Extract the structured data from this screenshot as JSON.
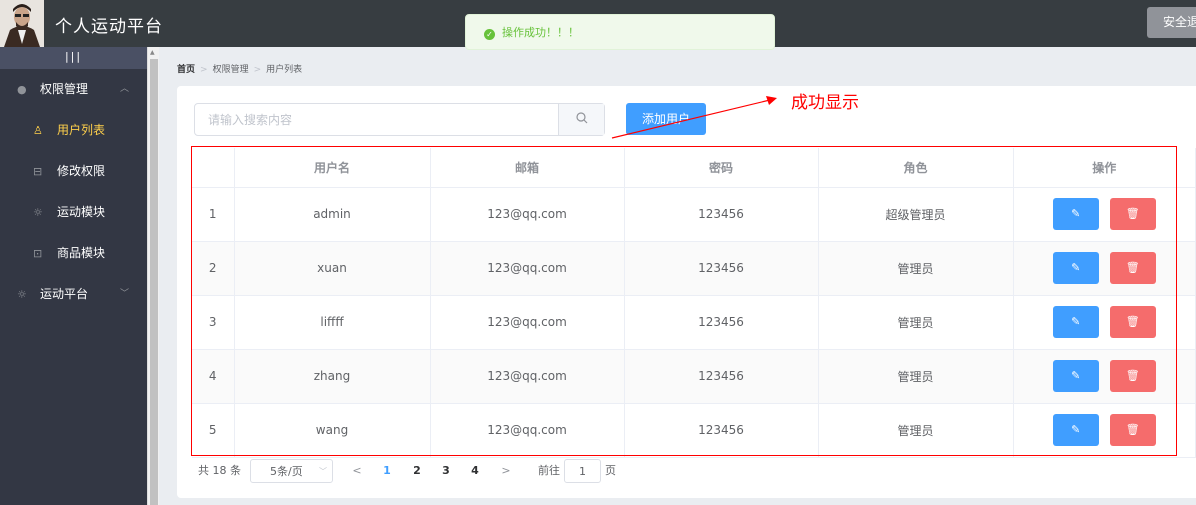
{
  "header": {
    "title": "个人运动平台",
    "logout_label": "安全退出"
  },
  "toast": {
    "icon": "check-circle-icon",
    "message": "操作成功！！！",
    "color": "#67c23a"
  },
  "sidebar": {
    "toggle_label": "|||",
    "items": [
      {
        "label": "权限管理",
        "icon": "user-icon",
        "expanded": true
      },
      {
        "label": "用户列表",
        "icon": "user-outline-icon",
        "active": true
      },
      {
        "label": "修改权限",
        "icon": "lock-icon"
      },
      {
        "label": "运动模块",
        "icon": "sun-icon"
      },
      {
        "label": "商品模块",
        "icon": "goods-icon"
      },
      {
        "label": "运动平台",
        "icon": "sun-icon",
        "expanded": false
      }
    ],
    "active_color": "#ffd04b"
  },
  "breadcrumb": [
    "首页",
    "权限管理",
    "用户列表"
  ],
  "search": {
    "placeholder": "请输入搜索内容",
    "value": ""
  },
  "add_button_label": "添加用户",
  "annotation": {
    "text": "成功显示",
    "color": "#ff0000"
  },
  "table": {
    "columns": [
      "",
      "用户名",
      "邮箱",
      "密码",
      "角色",
      "操作"
    ],
    "rows": [
      {
        "index": "1",
        "username": "admin",
        "email": "123@qq.com",
        "password": "123456",
        "role": "超级管理员"
      },
      {
        "index": "2",
        "username": "xuan",
        "email": "123@qq.com",
        "password": "123456",
        "role": "管理员"
      },
      {
        "index": "3",
        "username": "liffff",
        "email": "123@qq.com",
        "password": "123456",
        "role": "管理员"
      },
      {
        "index": "4",
        "username": "zhang",
        "email": "123@qq.com",
        "password": "123456",
        "role": "管理员"
      },
      {
        "index": "5",
        "username": "wang",
        "email": "123@qq.com",
        "password": "123456",
        "role": "管理员"
      }
    ]
  },
  "pagination": {
    "total": "共 18 条",
    "page_size": "5条/页",
    "pages": [
      "1",
      "2",
      "3",
      "4"
    ],
    "current": "1",
    "jump_prefix": "前往",
    "jump_value": "1",
    "jump_suffix": "页"
  },
  "colors": {
    "primary": "#409eff",
    "danger": "#f56c6c",
    "header": "#373d41",
    "sidebar": "#333744"
  }
}
